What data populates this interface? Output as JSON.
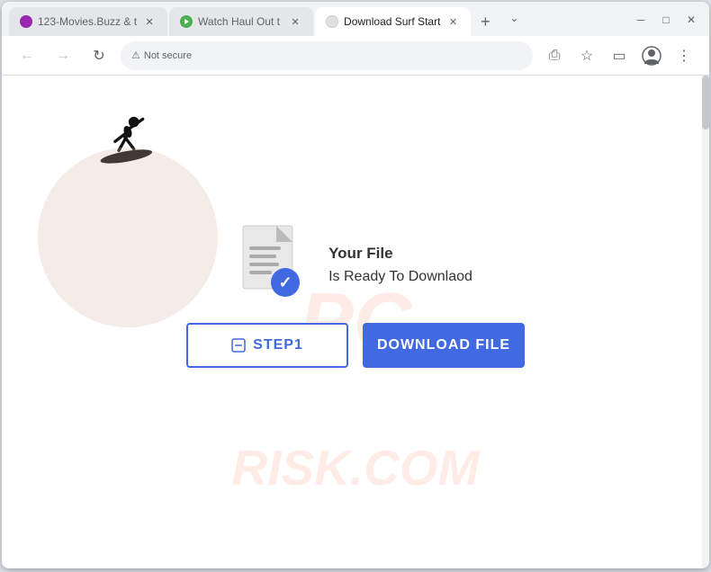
{
  "window": {
    "title": "Download Surf Start"
  },
  "tabs": [
    {
      "id": "tab-1",
      "label": "123-Movies.Buzz & t",
      "favicon_color": "#9c27b0",
      "active": false
    },
    {
      "id": "tab-2",
      "label": "Watch Haul Out t",
      "favicon_color": "#4caf50",
      "active": false
    },
    {
      "id": "tab-3",
      "label": "Download Surf Start",
      "favicon_color": "#9e9e9e",
      "active": true
    }
  ],
  "nav": {
    "security_label": "Not secure",
    "url": ""
  },
  "page": {
    "file_ready_line1": "Your File",
    "file_ready_line2": "Is Ready To Downlaod",
    "btn_step1_label": "STEP1",
    "btn_download_label": "DOWNLOAD FILE",
    "watermark_top": "PC",
    "watermark_bottom": "RISK.COM"
  },
  "icons": {
    "back": "←",
    "forward": "→",
    "reload": "↻",
    "warning": "⚠",
    "share": "⎙",
    "star": "☆",
    "cast": "▭",
    "profile": "◯",
    "menu": "⋮",
    "close": "✕",
    "new_tab": "+",
    "minimize": "─",
    "maximize": "□",
    "close_win": "✕",
    "chevron_down": "⌄",
    "check": "✓"
  }
}
